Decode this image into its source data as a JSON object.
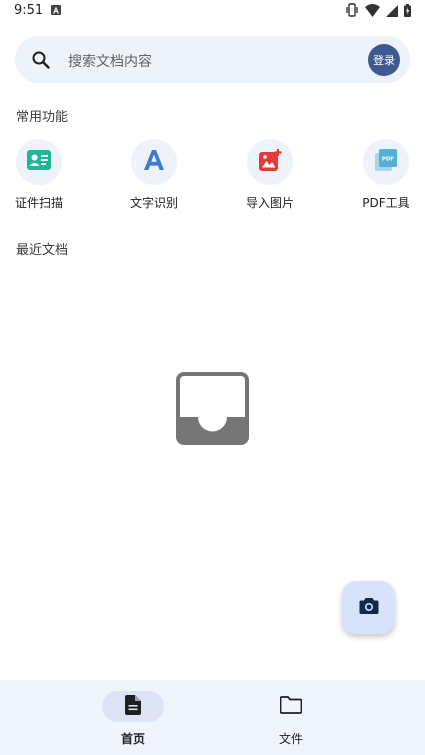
{
  "status_bar": {
    "time": "9:51"
  },
  "search": {
    "placeholder": "搜索文档内容",
    "login_label": "登录"
  },
  "sections": {
    "common": "常用功能",
    "recent": "最近文档"
  },
  "functions": [
    {
      "label": "证件扫描",
      "icon": "id-card-icon",
      "color": "#1fb79a"
    },
    {
      "label": "文字识别",
      "icon": "text-recognition-icon",
      "color": "#3a7bd5"
    },
    {
      "label": "导入图片",
      "icon": "import-image-icon",
      "color": "#e53935"
    },
    {
      "label": "PDF工具",
      "icon": "pdf-tools-icon",
      "color": "#55b0d6"
    }
  ],
  "empty_state_icon": "empty-inbox-icon",
  "fab_icon": "camera-icon",
  "bottom_nav": {
    "items": [
      {
        "label": "首页",
        "icon": "document-icon",
        "active": true
      },
      {
        "label": "文件",
        "icon": "folder-icon",
        "active": false
      }
    ]
  },
  "colors": {
    "accent": "#3f5a91",
    "surface": "#eef2fa",
    "fab": "#d7e3fb"
  }
}
